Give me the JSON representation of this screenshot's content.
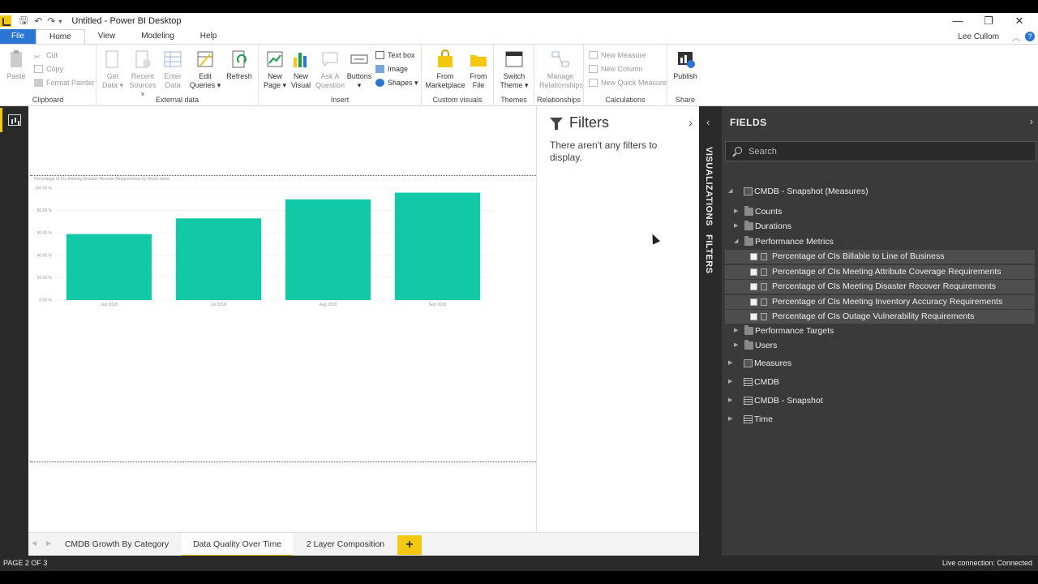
{
  "window": {
    "title": "Untitled - Power BI Desktop",
    "controls": {
      "minimize": "—",
      "maximize": "❐",
      "close": "✕"
    }
  },
  "menu": {
    "tabs": [
      "File",
      "Home",
      "View",
      "Modeling",
      "Help"
    ],
    "active": "Home",
    "user": "Lee Cullom",
    "help": "?"
  },
  "ribbon": {
    "clipboard": {
      "label": "Clipboard",
      "paste": "Paste",
      "cut": "Cut",
      "copy": "Copy",
      "format_painter": "Format Painter"
    },
    "external": {
      "label": "External data",
      "get_data": "Get Data",
      "recent_sources": "Recent Sources",
      "enter_data": "Enter Data",
      "edit_queries": "Edit Queries",
      "refresh": "Refresh"
    },
    "insert": {
      "label": "Insert",
      "new_page": "New Page",
      "new_visual": "New Visual",
      "ask_question": "Ask A Question",
      "buttons": "Buttons",
      "text_box": "Text box",
      "image": "Image",
      "shapes": "Shapes"
    },
    "custom_visuals": {
      "label": "Custom visuals",
      "from_marketplace": "From Marketplace",
      "from_file": "From File"
    },
    "themes": {
      "label": "Themes",
      "switch_theme": "Switch Theme"
    },
    "relationships": {
      "label": "Relationships",
      "manage": "Manage Relationships"
    },
    "calculations": {
      "label": "Calculations",
      "new_measure": "New Measure",
      "new_column": "New Column",
      "new_quick_measure": "New Quick Measure"
    },
    "share": {
      "label": "Share",
      "publish": "Publish"
    },
    "colors": {
      "accent_yellow": "#f2c811",
      "file_blue": "#2b76d2"
    }
  },
  "filters": {
    "title": "Filters",
    "empty_message": "There aren't any filters to display."
  },
  "side_tabs": {
    "visualizations": "VISUALIZATIONS",
    "filters": "FILTERS"
  },
  "fields": {
    "title": "FIELDS",
    "search_placeholder": "Search",
    "tree": [
      {
        "label": "CMDB - Snapshot (Measures)",
        "icon": "calc-icon",
        "expanded": true,
        "children": [
          {
            "label": "Counts",
            "icon": "folder-icon"
          },
          {
            "label": "Durations",
            "icon": "folder-icon"
          },
          {
            "label": "Performance Metrics",
            "icon": "folder-icon",
            "expanded": true,
            "children": [
              "Percentage of CIs Billable to Line of Business",
              "Percentage of CIs Meeting Attribute Coverage Requirements",
              "Percentage of CIs Meeting Disaster Recover Requirements",
              "Percentage of CIs Meeting Inventory Accuracy Requirements",
              "Percentage of CIs Outage Vulnerability Requirements"
            ]
          },
          {
            "label": "Performance Targets",
            "icon": "folder-icon"
          },
          {
            "label": "Users",
            "icon": "folder-icon"
          }
        ]
      },
      {
        "label": "Measures",
        "icon": "calc-icon"
      },
      {
        "label": "CMDB",
        "icon": "table-icon"
      },
      {
        "label": "CMDB - Snapshot",
        "icon": "table-icon"
      },
      {
        "label": "Time",
        "icon": "table-icon"
      }
    ]
  },
  "chart_data": {
    "type": "bar",
    "title": "Percentage of CIs Meeting Disaster Recover Requirements by Month.Value",
    "categories": [
      "Jun 2018",
      "Jul 2018",
      "Aug 2018",
      "Sep 2018"
    ],
    "values": [
      59,
      73,
      90,
      96
    ],
    "ylim": [
      0,
      100
    ],
    "yticks": [
      "0.00 %",
      "20.00 %",
      "40.00 %",
      "60.00 %",
      "80.00 %",
      "100.00 %"
    ],
    "xlabel": "",
    "ylabel": "",
    "grid": true,
    "color": "#12c9a7"
  },
  "pages": {
    "tabs": [
      "CMDB Growth By Category",
      "Data Quality Over Time",
      "2 Layer Composition"
    ],
    "active_index": 1,
    "add": "+"
  },
  "status": {
    "page": "PAGE 2 OF 3",
    "connection": "Live connection: Connected"
  }
}
